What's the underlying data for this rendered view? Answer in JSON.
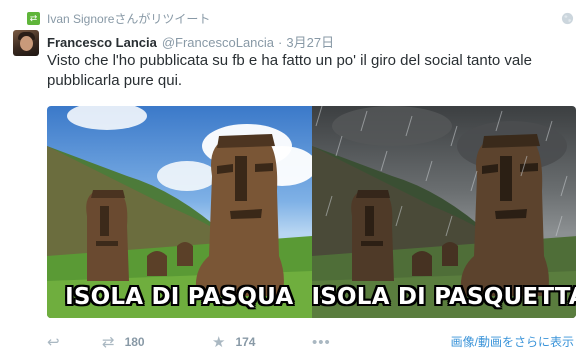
{
  "retweet_context": {
    "icon": "retweet-icon",
    "text": "Ivan Signoreさんがリツイート"
  },
  "tweet": {
    "author_name": "Francesco Lancia",
    "author_handle": "@FrancescoLancia",
    "separator": "·",
    "timestamp": "3月27日",
    "text": "Visto che l'ho pubblicata su fb e ha fatto un po' il giro del social tanto vale pubblicarla pure qui."
  },
  "media": {
    "left_caption": "ISOLA DI PASQUA",
    "right_caption": "ISOLA DI PASQUETTA"
  },
  "actions": {
    "reply_icon": "reply-icon",
    "retweet_icon": "retweet-icon",
    "retweet_count": "180",
    "favorite_icon": "star-icon",
    "favorite_count": "174",
    "more_icon": "more-icon",
    "view_media": "画像/動画をさらに表示"
  },
  "colors": {
    "link": "#3b94d9",
    "muted": "#8899a6",
    "retweet_green": "#5fb53a"
  }
}
